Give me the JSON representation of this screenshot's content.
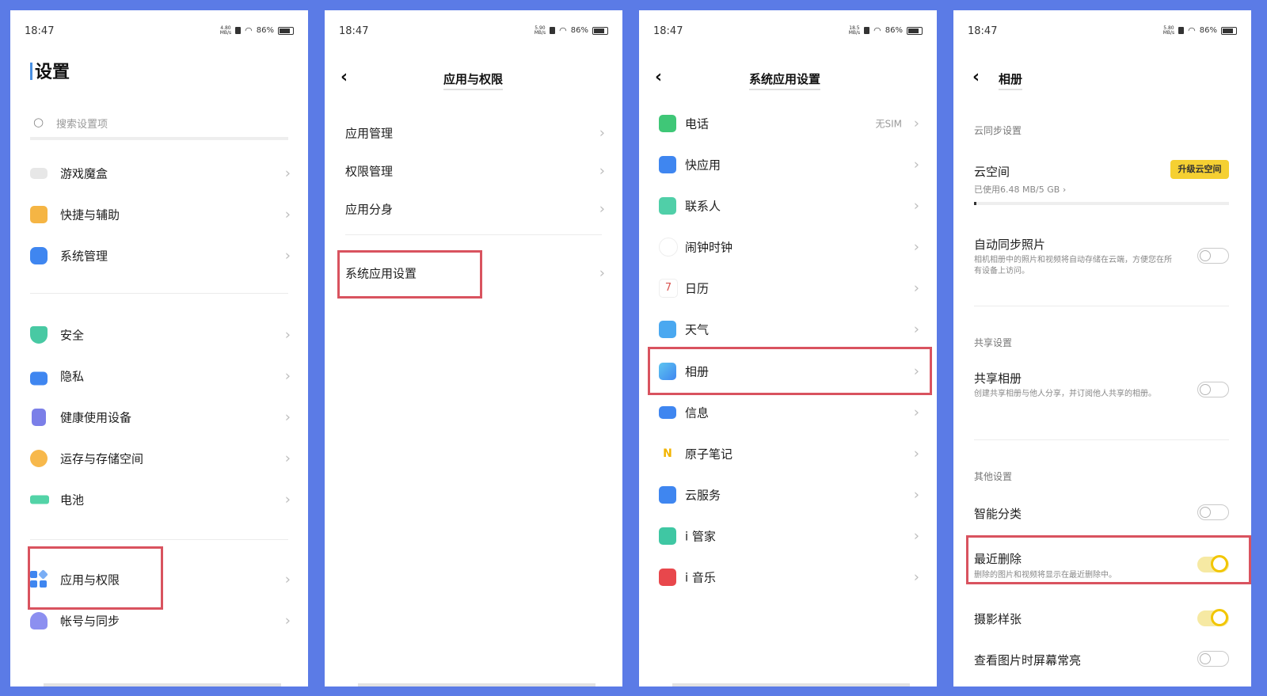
{
  "status": {
    "time": "18:47",
    "battery": "86%",
    "net_speeds": [
      "4.80",
      "5.90",
      "18.5",
      "5.80"
    ],
    "net_unit": "MB/s"
  },
  "panel1": {
    "title": "设置",
    "search_placeholder": "搜索设置项",
    "items": [
      "游戏魔盒",
      "快捷与辅助",
      "系统管理",
      "安全",
      "隐私",
      "健康使用设备",
      "运存与存储空间",
      "电池",
      "应用与权限",
      "帐号与同步"
    ]
  },
  "panel2": {
    "title": "应用与权限",
    "items": [
      "应用管理",
      "权限管理",
      "应用分身",
      "系统应用设置"
    ]
  },
  "panel3": {
    "title": "系统应用设置",
    "items": [
      "电话",
      "快应用",
      "联系人",
      "闹钟时钟",
      "日历",
      "天气",
      "相册",
      "信息",
      "原子笔记",
      "云服务",
      "i 管家",
      "i 音乐"
    ],
    "phone_value": "无SIM"
  },
  "panel4": {
    "title": "相册",
    "section_cloud": "云同步设置",
    "cloud_space": "云空间",
    "cloud_used": "已使用6.48 MB/5 GB",
    "cloud_usage_fraction": 0.0013,
    "upgrade_button": "升级云空间",
    "auto_sync": "自动同步照片",
    "auto_sync_desc": "相机相册中的照片和视频将自动存储在云端，方便您在所有设备上访问。",
    "section_share": "共享设置",
    "shared_album": "共享相册",
    "shared_album_desc": "创建共享相册与他人分享，并订阅他人共享的相册。",
    "section_other": "其他设置",
    "smart_classify": "智能分类",
    "recent_delete": "最近删除",
    "recent_delete_desc": "删除的图片和视频将显示在最近删除中。",
    "photo_sample": "摄影样张",
    "screen_on": "查看图片时屏幕常亮"
  },
  "colors": {
    "background": "#5b7be6",
    "highlight": "#d9535f",
    "toggle_on": "#f2c600",
    "upgrade": "#f5d032"
  }
}
